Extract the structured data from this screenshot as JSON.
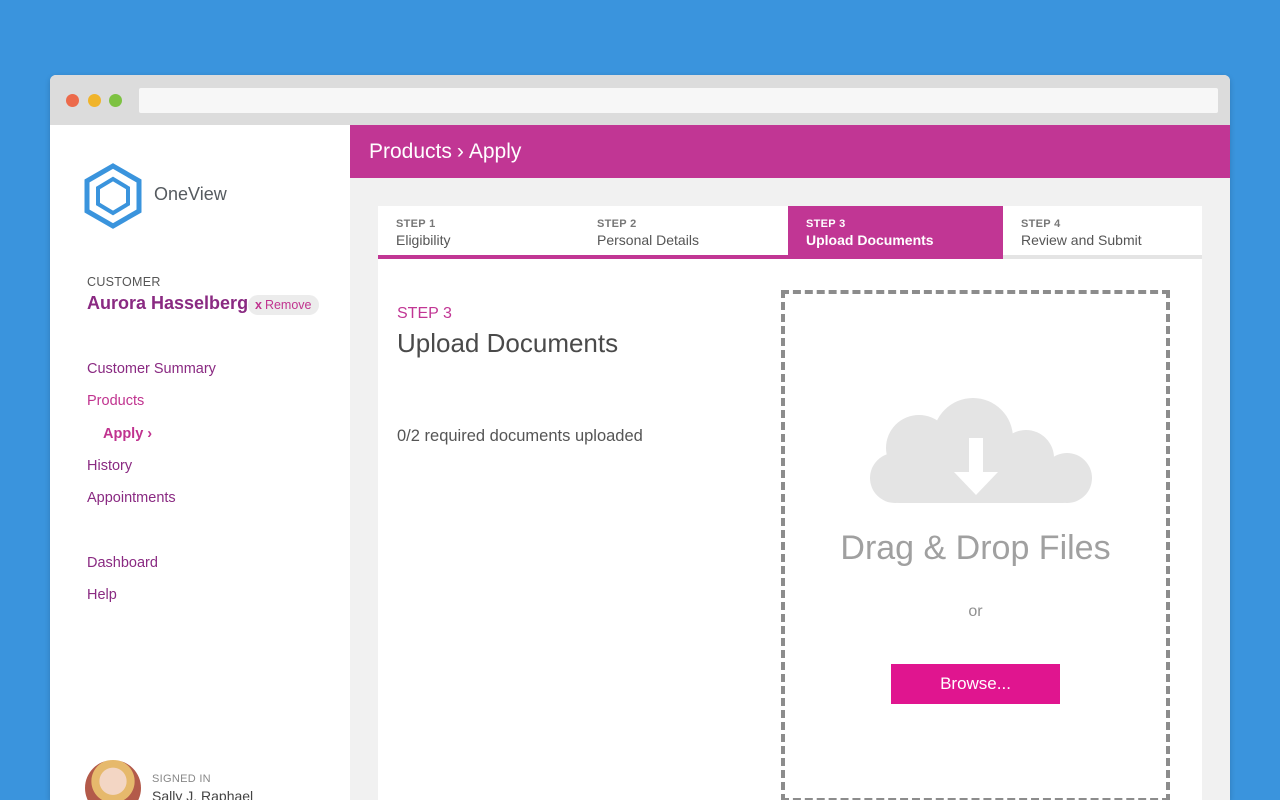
{
  "app": {
    "name": "OneView"
  },
  "customer": {
    "label": "CUSTOMER",
    "name": "Aurora Hasselberg",
    "remove_icon": "x",
    "remove_label": "Remove"
  },
  "nav": {
    "customer_summary": "Customer Summary",
    "products": "Products",
    "apply": "Apply ›",
    "history": "History",
    "appointments": "Appointments",
    "dashboard": "Dashboard",
    "help": "Help"
  },
  "user": {
    "signed_in_label": "SIGNED IN",
    "name": "Sally J. Raphael"
  },
  "header": {
    "crumb_products": "Products",
    "crumb_sep": "›",
    "crumb_apply": "Apply"
  },
  "steps": [
    {
      "num": "STEP 1",
      "label": "Eligibility",
      "state": "complete"
    },
    {
      "num": "STEP 2",
      "label": "Personal Details",
      "state": "complete"
    },
    {
      "num": "STEP 3",
      "label": "Upload Documents",
      "state": "active"
    },
    {
      "num": "STEP 4",
      "label": "Review and Submit",
      "state": "pending"
    }
  ],
  "upload": {
    "kicker": "STEP 3",
    "title": "Upload Documents",
    "status": "0/2 required documents uploaded",
    "drop_title": "Drag & Drop Files",
    "or": "or",
    "browse": "Browse..."
  },
  "colors": {
    "background": "#3a94dd",
    "brand": "#c13694",
    "browse_button": "#e0158f",
    "nav_text": "#8a2a82",
    "logo": "#3a94dd"
  },
  "icons": {
    "logo": "hexagon-logo-icon",
    "upload": "cloud-download-icon"
  }
}
